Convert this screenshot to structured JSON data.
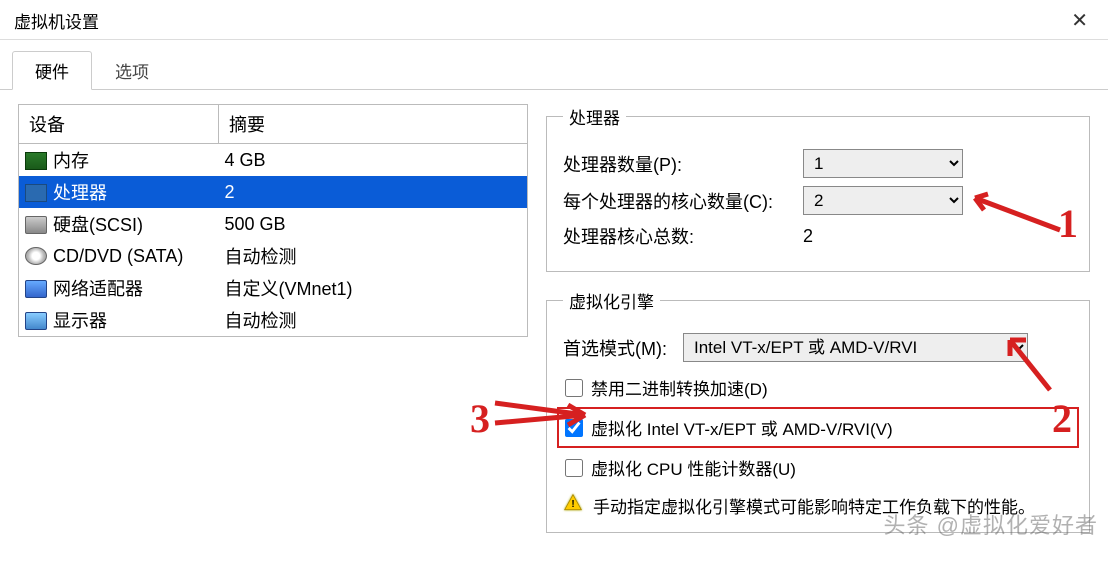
{
  "window": {
    "title": "虚拟机设置"
  },
  "tabs": {
    "hardware": "硬件",
    "options": "选项"
  },
  "deviceTable": {
    "header_device": "设备",
    "header_summary": "摘要",
    "rows": [
      {
        "name": "内存",
        "summary": "4 GB",
        "icon": "memory"
      },
      {
        "name": "处理器",
        "summary": "2",
        "icon": "cpu",
        "selected": true
      },
      {
        "name": "硬盘(SCSI)",
        "summary": "500 GB",
        "icon": "disk"
      },
      {
        "name": "CD/DVD (SATA)",
        "summary": "自动检测",
        "icon": "cd"
      },
      {
        "name": "网络适配器",
        "summary": "自定义(VMnet1)",
        "icon": "net"
      },
      {
        "name": "显示器",
        "summary": "自动检测",
        "icon": "display"
      }
    ]
  },
  "processor": {
    "legend": "处理器",
    "count_label": "处理器数量(P):",
    "count_value": "1",
    "cores_label": "每个处理器的核心数量(C):",
    "cores_value": "2",
    "total_label": "处理器核心总数:",
    "total_value": "2"
  },
  "virtEngine": {
    "legend": "虚拟化引擎",
    "preferred_label": "首选模式(M):",
    "preferred_value": "Intel VT-x/EPT 或 AMD-V/RVI",
    "check_binary": "禁用二进制转换加速(D)",
    "check_vtx": "虚拟化 Intel VT-x/EPT 或 AMD-V/RVI(V)",
    "check_cpu_perf": "虚拟化 CPU 性能计数器(U)",
    "warning": "手动指定虚拟化引擎模式可能影响特定工作负载下的性能。"
  },
  "watermark": "头条 @虚拟化爱好者"
}
